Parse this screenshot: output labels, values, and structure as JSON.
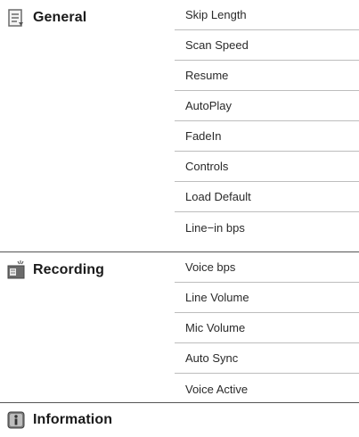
{
  "sections": [
    {
      "title": "General",
      "icon": "document-list-icon",
      "items": [
        "Skip Length",
        "Scan Speed",
        "Resume",
        "AutoPlay",
        "FadeIn",
        "Controls",
        "Load Default",
        "Line−in bps"
      ]
    },
    {
      "title": "Recording",
      "icon": "recording-document-icon",
      "items": [
        "Voice bps",
        "Line Volume",
        "Mic Volume",
        "Auto Sync",
        "Voice Active"
      ]
    },
    {
      "title": "Information",
      "icon": "information-icon",
      "items": []
    }
  ]
}
